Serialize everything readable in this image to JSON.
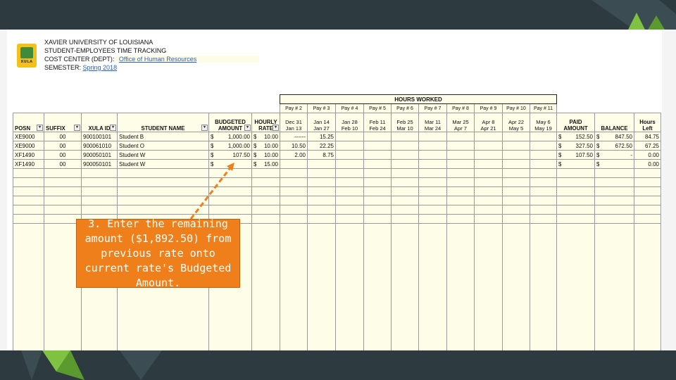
{
  "header": {
    "line1": "XAVIER UNIVERSITY OF LOUISIANA",
    "line2": "STUDENT-EMPLOYEES TIME TRACKING",
    "line3_label": "COST CENTER (DEPT):",
    "line3_value": "Office of Human Resources",
    "line4_label": "SEMESTER:",
    "line4_value": "Spring 2018"
  },
  "logo": {
    "text": "XULA",
    "icon": "xula-shield-icon"
  },
  "hours_worked_title": "HOURS WORKED",
  "pay_periods": [
    {
      "pay": "Pay # 2",
      "d1": "Dec 31",
      "d2": "Jan 13"
    },
    {
      "pay": "Pay # 3",
      "d1": "Jan 14",
      "d2": "Jan 27"
    },
    {
      "pay": "Pay # 4",
      "d1": "Jan 28",
      "d2": "Feb 10"
    },
    {
      "pay": "Pay # 5",
      "d1": "Feb 11",
      "d2": "Feb 24"
    },
    {
      "pay": "Pay # 6",
      "d1": "Feb 25",
      "d2": "Mar 10"
    },
    {
      "pay": "Pay # 7",
      "d1": "Mar 11",
      "d2": "Mar 24"
    },
    {
      "pay": "Pay # 8",
      "d1": "Mar 25",
      "d2": "Apr 7"
    },
    {
      "pay": "Pay # 9",
      "d1": "Apr 8",
      "d2": "Apr 21"
    },
    {
      "pay": "Pay # 10",
      "d1": "Apr 22",
      "d2": "May 5"
    },
    {
      "pay": "Pay # 11",
      "d1": "May 6",
      "d2": "May 19"
    }
  ],
  "columns": {
    "posn": "POSN",
    "suffix": "SUFFIX",
    "xula_id": "XULA ID",
    "student_name": "STUDENT NAME",
    "budgeted_1": "BUDGETED",
    "budgeted_2": "AMOUNT",
    "hourly_1": "HOURLY",
    "hourly_2": "RATE",
    "paid_1": "PAID",
    "paid_2": "AMOUNT",
    "balance": "BALANCE",
    "hours_1": "Hours",
    "hours_2": "Left"
  },
  "rows": [
    {
      "posn": "XE9000",
      "suffix": "00",
      "xula_id": "900100101",
      "name": "Student B",
      "budget": "1,000.00",
      "rate": "10.00",
      "hours": [
        "------",
        "15.25",
        "",
        "",
        "",
        "",
        "",
        "",
        "",
        ""
      ],
      "paid": "152.50",
      "balance": "847.50",
      "left": "84.75"
    },
    {
      "posn": "XE9000",
      "suffix": "00",
      "xula_id": "900061010",
      "name": "Student O",
      "budget": "1,000.00",
      "rate": "10.00",
      "hours": [
        "10.50",
        "22.25",
        "",
        "",
        "",
        "",
        "",
        "",
        "",
        ""
      ],
      "paid": "327.50",
      "balance": "672.50",
      "left": "67.25"
    },
    {
      "posn": "XF1490",
      "suffix": "00",
      "xula_id": "900050101",
      "name": "Student W",
      "budget": "107.50",
      "rate": "10.00",
      "hours": [
        "2.00",
        "8.75",
        "",
        "",
        "",
        "",
        "",
        "",
        "",
        ""
      ],
      "paid": "107.50",
      "balance": "-",
      "left": "0.00"
    },
    {
      "posn": "XF1490",
      "suffix": "00",
      "xula_id": "900050101",
      "name": "Student W",
      "budget": "",
      "rate": "15.00",
      "hours": [
        "",
        "",
        "",
        "",
        "",
        "",
        "",
        "",
        "",
        ""
      ],
      "paid": "",
      "balance": "",
      "left": "0.00"
    }
  ],
  "currency": "$",
  "callout": {
    "text": "3. Enter the remaining amount ($1,892.50) from previous rate onto current rate's Budgeted Amount."
  },
  "colors": {
    "frame": "#2d3b40",
    "accent_green": "#7fc241",
    "callout": "#ef7f1a",
    "cream": "#fdfde8"
  }
}
